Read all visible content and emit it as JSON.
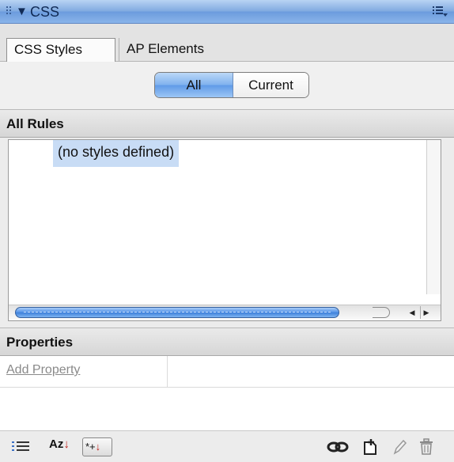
{
  "panel": {
    "title": "CSS",
    "collapse_glyph": "▼"
  },
  "tabs": [
    {
      "label": "CSS Styles",
      "active": true
    },
    {
      "label": "AP Elements",
      "active": false
    }
  ],
  "mode_toggle": {
    "options": [
      "All",
      "Current"
    ],
    "selected": "All"
  },
  "rules": {
    "header": "All Rules",
    "items": [
      "(no styles defined)"
    ]
  },
  "properties": {
    "header": "Properties",
    "add_property_label": "Add Property"
  },
  "toolbar": {
    "alpha_glyph": "Az",
    "set_glyph": "*+",
    "icons": [
      "category-view-icon",
      "alphabetical-view-icon",
      "set-properties-view-icon",
      "attach-stylesheet-icon",
      "new-css-rule-icon",
      "edit-style-icon",
      "delete-css-rule-icon"
    ]
  },
  "colors": {
    "accent": "#6b9bdd",
    "selection": "#c8dcf5",
    "sort_arrow": "#c0211b"
  }
}
